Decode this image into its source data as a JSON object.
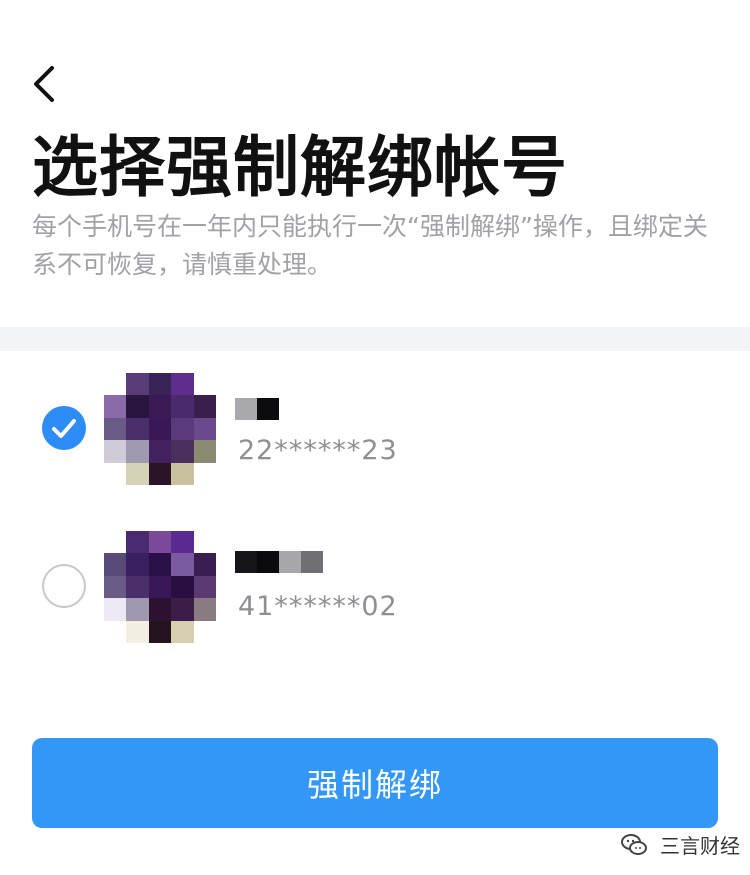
{
  "page": {
    "title": "选择强制解绑帐号",
    "description": "每个手机号在一年内只能执行一次“强制解绑”操作，且绑定关系不可恢复，请慎重处理。"
  },
  "nav": {
    "back_icon": "chevron-left-icon"
  },
  "accounts": [
    {
      "selected": true,
      "id_masked": "22******23",
      "name_redacted": true,
      "avatar_redacted": true
    },
    {
      "selected": false,
      "id_masked": "41******02",
      "name_redacted": true,
      "avatar_redacted": true
    }
  ],
  "actions": {
    "primary_label": "强制解绑"
  },
  "watermark": {
    "label": "三言财经",
    "icon": "wechat-icon"
  },
  "colors": {
    "accent": "#2d8cf6",
    "button": "#3397f8",
    "secondary_text": "#a1a1a6",
    "divider": "#f3f4f8"
  }
}
